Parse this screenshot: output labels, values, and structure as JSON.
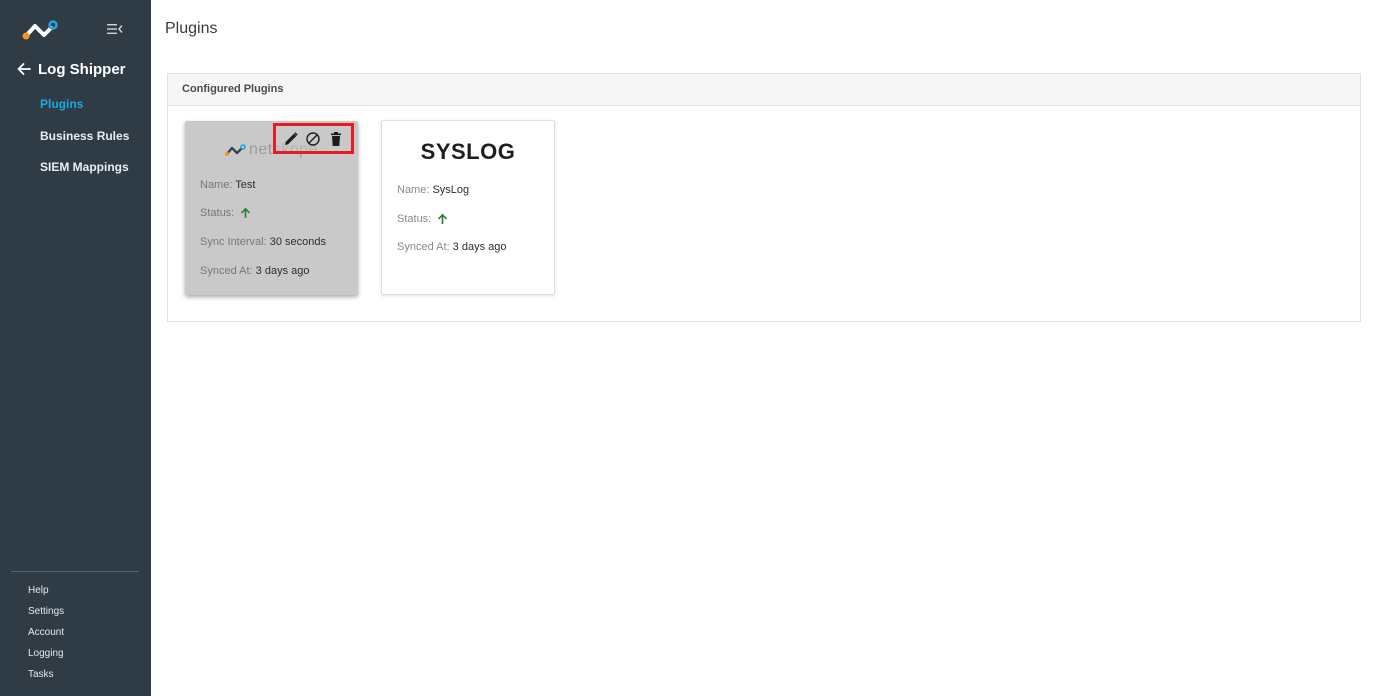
{
  "app": {
    "section_title": "Log Shipper",
    "logo_icon": "netskope-logo-icon",
    "brand_colors": {
      "orange": "#f7931e",
      "blue": "#1ba8e3",
      "dark": "#2f3c45"
    }
  },
  "sidebar": {
    "nav": [
      {
        "label": "Plugins",
        "active": true
      },
      {
        "label": "Business Rules",
        "active": false
      },
      {
        "label": "SIEM Mappings",
        "active": false
      }
    ],
    "bottom_links": [
      "Help",
      "Settings",
      "Account",
      "Logging",
      "Tasks"
    ]
  },
  "page": {
    "title": "Plugins"
  },
  "panel": {
    "header": "Configured Plugins"
  },
  "cards": [
    {
      "logo_text": "netskope",
      "name_label": "Name:",
      "name_value": "Test",
      "status_label": "Status:",
      "status_icon": "arrow-up-icon",
      "status_color": "#2e7d32",
      "interval_label": "Sync Interval:",
      "interval_value": "30 seconds",
      "synced_label": "Synced At:",
      "synced_value": "3 days ago",
      "actions": [
        "edit-icon",
        "disable-icon",
        "delete-icon"
      ]
    },
    {
      "title": "SYSLOG",
      "name_label": "Name:",
      "name_value": "SysLog",
      "status_label": "Status:",
      "status_icon": "arrow-up-icon",
      "status_color": "#2e7d32",
      "synced_label": "Synced At:",
      "synced_value": "3 days ago"
    }
  ]
}
